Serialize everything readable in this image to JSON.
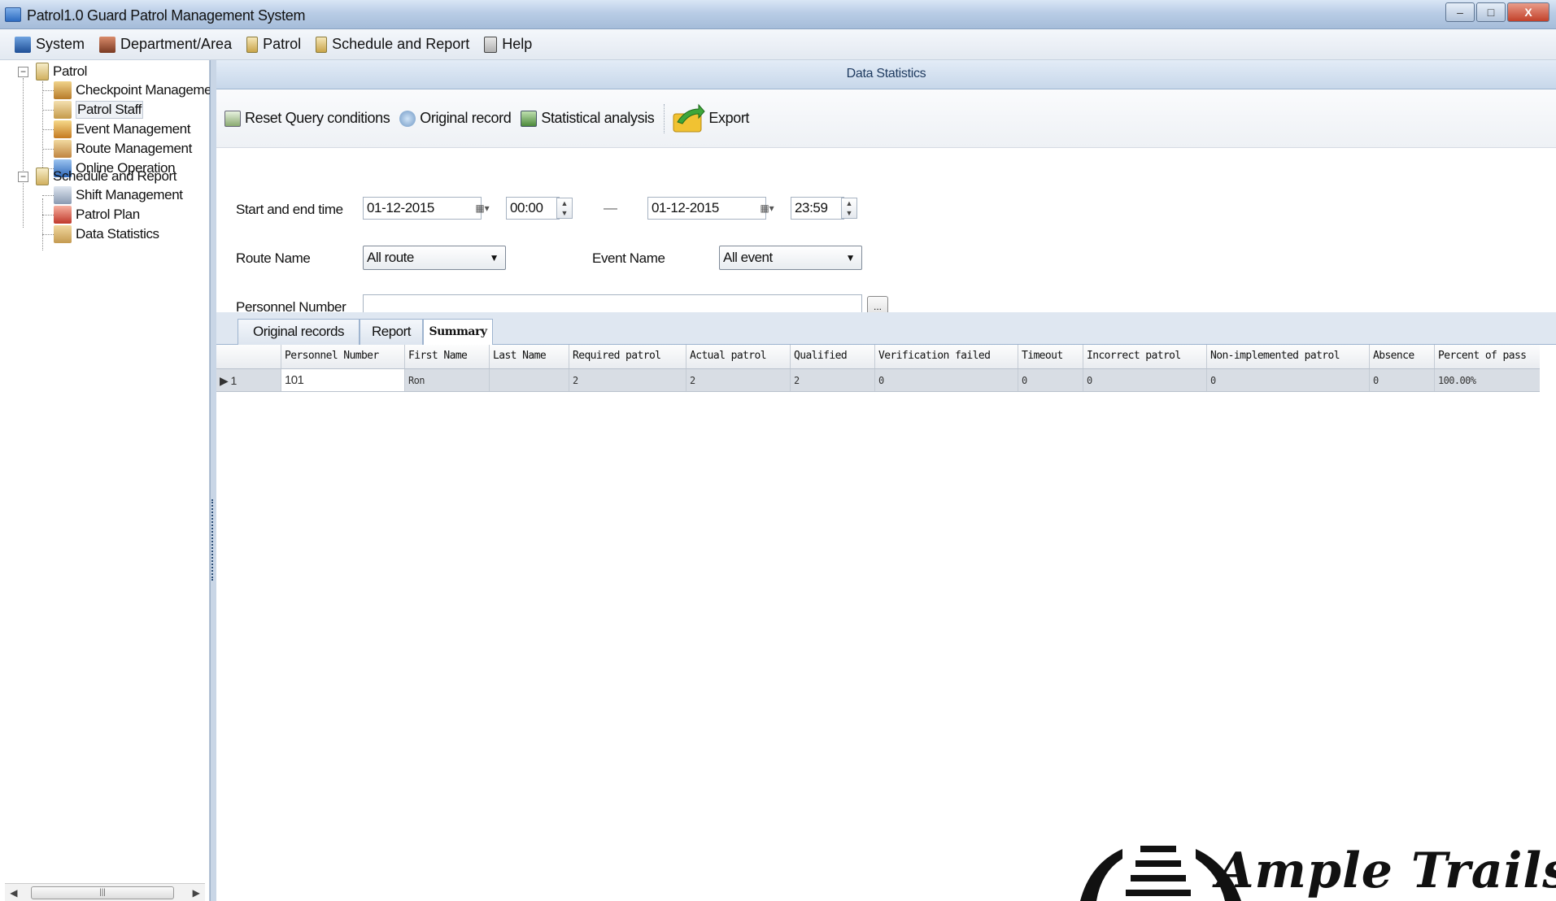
{
  "window": {
    "title": "Patrol1.0 Guard Patrol Management System",
    "minimize": "–",
    "maximize": "□",
    "close": "X"
  },
  "menu": [
    {
      "label": "System",
      "icon": "computer-icon"
    },
    {
      "label": "Department/Area",
      "icon": "department-icon"
    },
    {
      "label": "Patrol",
      "icon": "patrol-book-icon"
    },
    {
      "label": "Schedule and Report",
      "icon": "schedule-book-icon"
    },
    {
      "label": "Help",
      "icon": "help-book-icon"
    }
  ],
  "tree": {
    "patrol": {
      "label": "Patrol",
      "expander": "−"
    },
    "checkpoint": {
      "label": "Checkpoint Manageme"
    },
    "patrol_staff": {
      "label": "Patrol Staff"
    },
    "event": {
      "label": "Event Management"
    },
    "route": {
      "label": "Route Management"
    },
    "online": {
      "label": "Online Operation"
    },
    "schedule": {
      "label": "Schedule and Report",
      "expander": "−"
    },
    "shift": {
      "label": "Shift Management"
    },
    "plan": {
      "label": "Patrol Plan"
    },
    "stats": {
      "label": "Data Statistics"
    }
  },
  "panel": {
    "title": "Data Statistics"
  },
  "toolbar": {
    "reset": "Reset Query conditions",
    "original": "Original record",
    "statistical": "Statistical analysis",
    "export": "Export"
  },
  "form": {
    "time_label": "Start and end time",
    "start_date": "01-12-2015",
    "start_time": "00:00",
    "separator": "—",
    "end_date": "01-12-2015",
    "end_time": "23:59",
    "route_label": "Route Name",
    "route_value": "All route",
    "event_label": "Event Name",
    "event_value": "All event",
    "personnel_label": "Personnel Number",
    "personnel_value": "",
    "browse": "..."
  },
  "tabs": [
    "Original records",
    "Report",
    "Summary"
  ],
  "table": {
    "columns": [
      "Personnel Number",
      "First Name",
      "Last Name",
      "Required patrol",
      "Actual patrol",
      "Qualified",
      "Verification failed",
      "Timeout",
      "Incorrect patrol",
      "Non-implemented patrol",
      "Absence",
      "Percent of pass"
    ],
    "rows": [
      {
        "index": "1",
        "cells": [
          "101",
          "Ron",
          "",
          "2",
          "2",
          "2",
          "0",
          "0",
          "0",
          "0",
          "0",
          "100.00%"
        ]
      }
    ]
  },
  "watermark": {
    "text": "Ample Trails"
  },
  "colors": {
    "accent": "#c7d7ea",
    "selected_row": "#d8dde4"
  }
}
